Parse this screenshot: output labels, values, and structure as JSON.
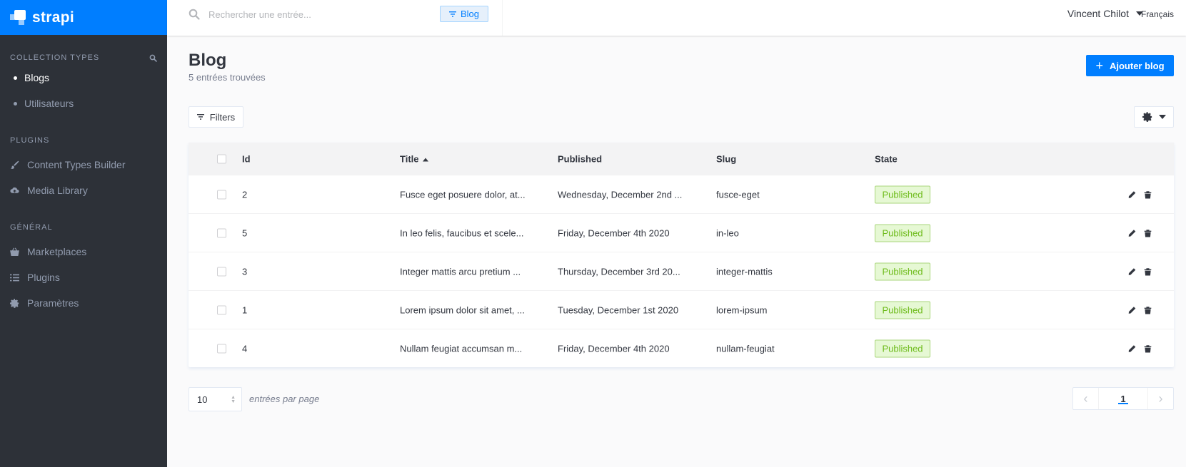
{
  "brand": {
    "name": "strapi"
  },
  "sidebar": {
    "sections": [
      {
        "title": "Collection Types",
        "items": [
          {
            "label": "Blogs",
            "active": true
          },
          {
            "label": "Utilisateurs",
            "active": false
          }
        ]
      },
      {
        "title": "Plugins",
        "items": [
          {
            "label": "Content Types Builder",
            "icon": "brush-icon"
          },
          {
            "label": "Media Library",
            "icon": "cloud-upload-icon"
          }
        ]
      },
      {
        "title": "Général",
        "items": [
          {
            "label": "Marketplaces",
            "icon": "basket-icon"
          },
          {
            "label": "Plugins",
            "icon": "list-icon"
          },
          {
            "label": "Paramètres",
            "icon": "gear-icon"
          }
        ]
      }
    ]
  },
  "header": {
    "search_placeholder": "Rechercher une entrée...",
    "search_tag": "Blog",
    "user_name": "Vincent Chilot",
    "language": "Français"
  },
  "page": {
    "title": "Blog",
    "subtitle": "5 entrées trouvées",
    "add_button": "Ajouter blog",
    "filters_button": "Filters"
  },
  "table": {
    "columns": [
      "Id",
      "Title",
      "Published",
      "Slug",
      "State"
    ],
    "sorted_column": "Title",
    "rows": [
      {
        "id": "2",
        "title": "Fusce eget posuere dolor, at...",
        "published": "Wednesday, December 2nd ...",
        "slug": "fusce-eget",
        "state": "Published"
      },
      {
        "id": "5",
        "title": "In leo felis, faucibus et scele...",
        "published": "Friday, December 4th 2020",
        "slug": "in-leo",
        "state": "Published"
      },
      {
        "id": "3",
        "title": "Integer mattis arcu pretium ...",
        "published": "Thursday, December 3rd 20...",
        "slug": "integer-mattis",
        "state": "Published"
      },
      {
        "id": "1",
        "title": "Lorem ipsum dolor sit amet, ...",
        "published": "Tuesday, December 1st 2020",
        "slug": "lorem-ipsum",
        "state": "Published"
      },
      {
        "id": "4",
        "title": "Nullam feugiat accumsan m...",
        "published": "Friday, December 4th 2020",
        "slug": "nullam-feugiat",
        "state": "Published"
      }
    ]
  },
  "footer": {
    "page_size": "10",
    "page_size_label": "entrées par page",
    "current_page": "1"
  },
  "colors": {
    "brand": "#007eff",
    "sidebar": "#2d3138",
    "published_badge": "#6dbb1a"
  }
}
